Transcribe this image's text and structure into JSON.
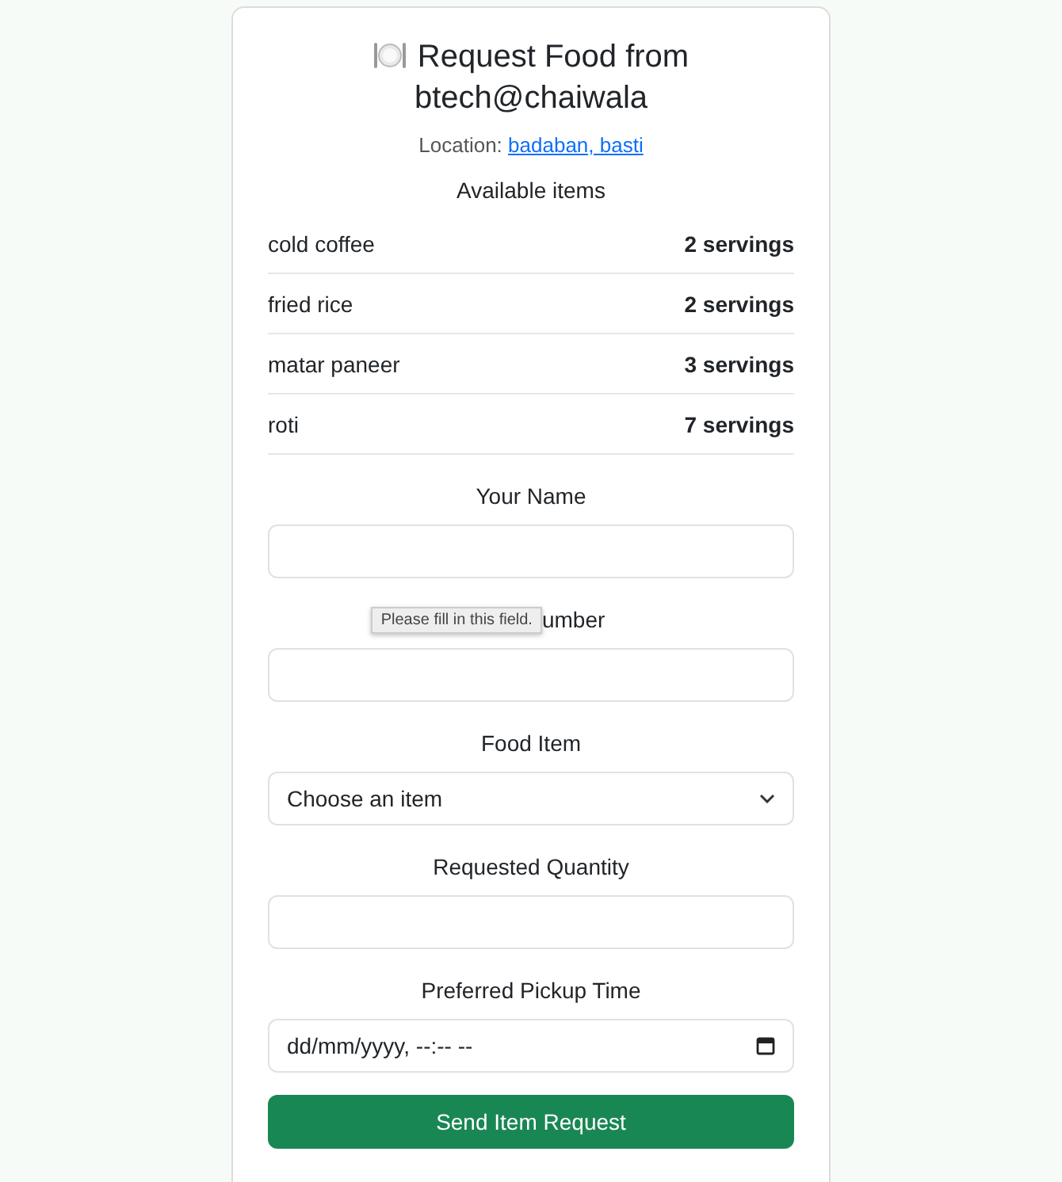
{
  "card": {
    "title": "Request Food from btech@chaiwala",
    "location_label": "Location:",
    "location_link": "badaban, basti"
  },
  "available": {
    "heading": "Available items",
    "items": [
      {
        "name": "cold coffee",
        "servings": "2 servings"
      },
      {
        "name": "fried rice",
        "servings": "2 servings"
      },
      {
        "name": "matar paneer",
        "servings": "3 servings"
      },
      {
        "name": "roti",
        "servings": "7 servings"
      }
    ]
  },
  "form": {
    "fields": [
      {
        "kind": "text",
        "label": "Your Name"
      },
      {
        "kind": "text",
        "label": "umber",
        "tooltip": "Please fill in this field."
      },
      {
        "kind": "select",
        "label": "Food Item",
        "value": "Choose an item"
      },
      {
        "kind": "text",
        "label": "Requested Quantity"
      },
      {
        "kind": "datetime",
        "label": "Preferred Pickup Time",
        "value": "dd/mm/yyyy, --:-- --"
      }
    ],
    "submit": "Send Item Request"
  }
}
